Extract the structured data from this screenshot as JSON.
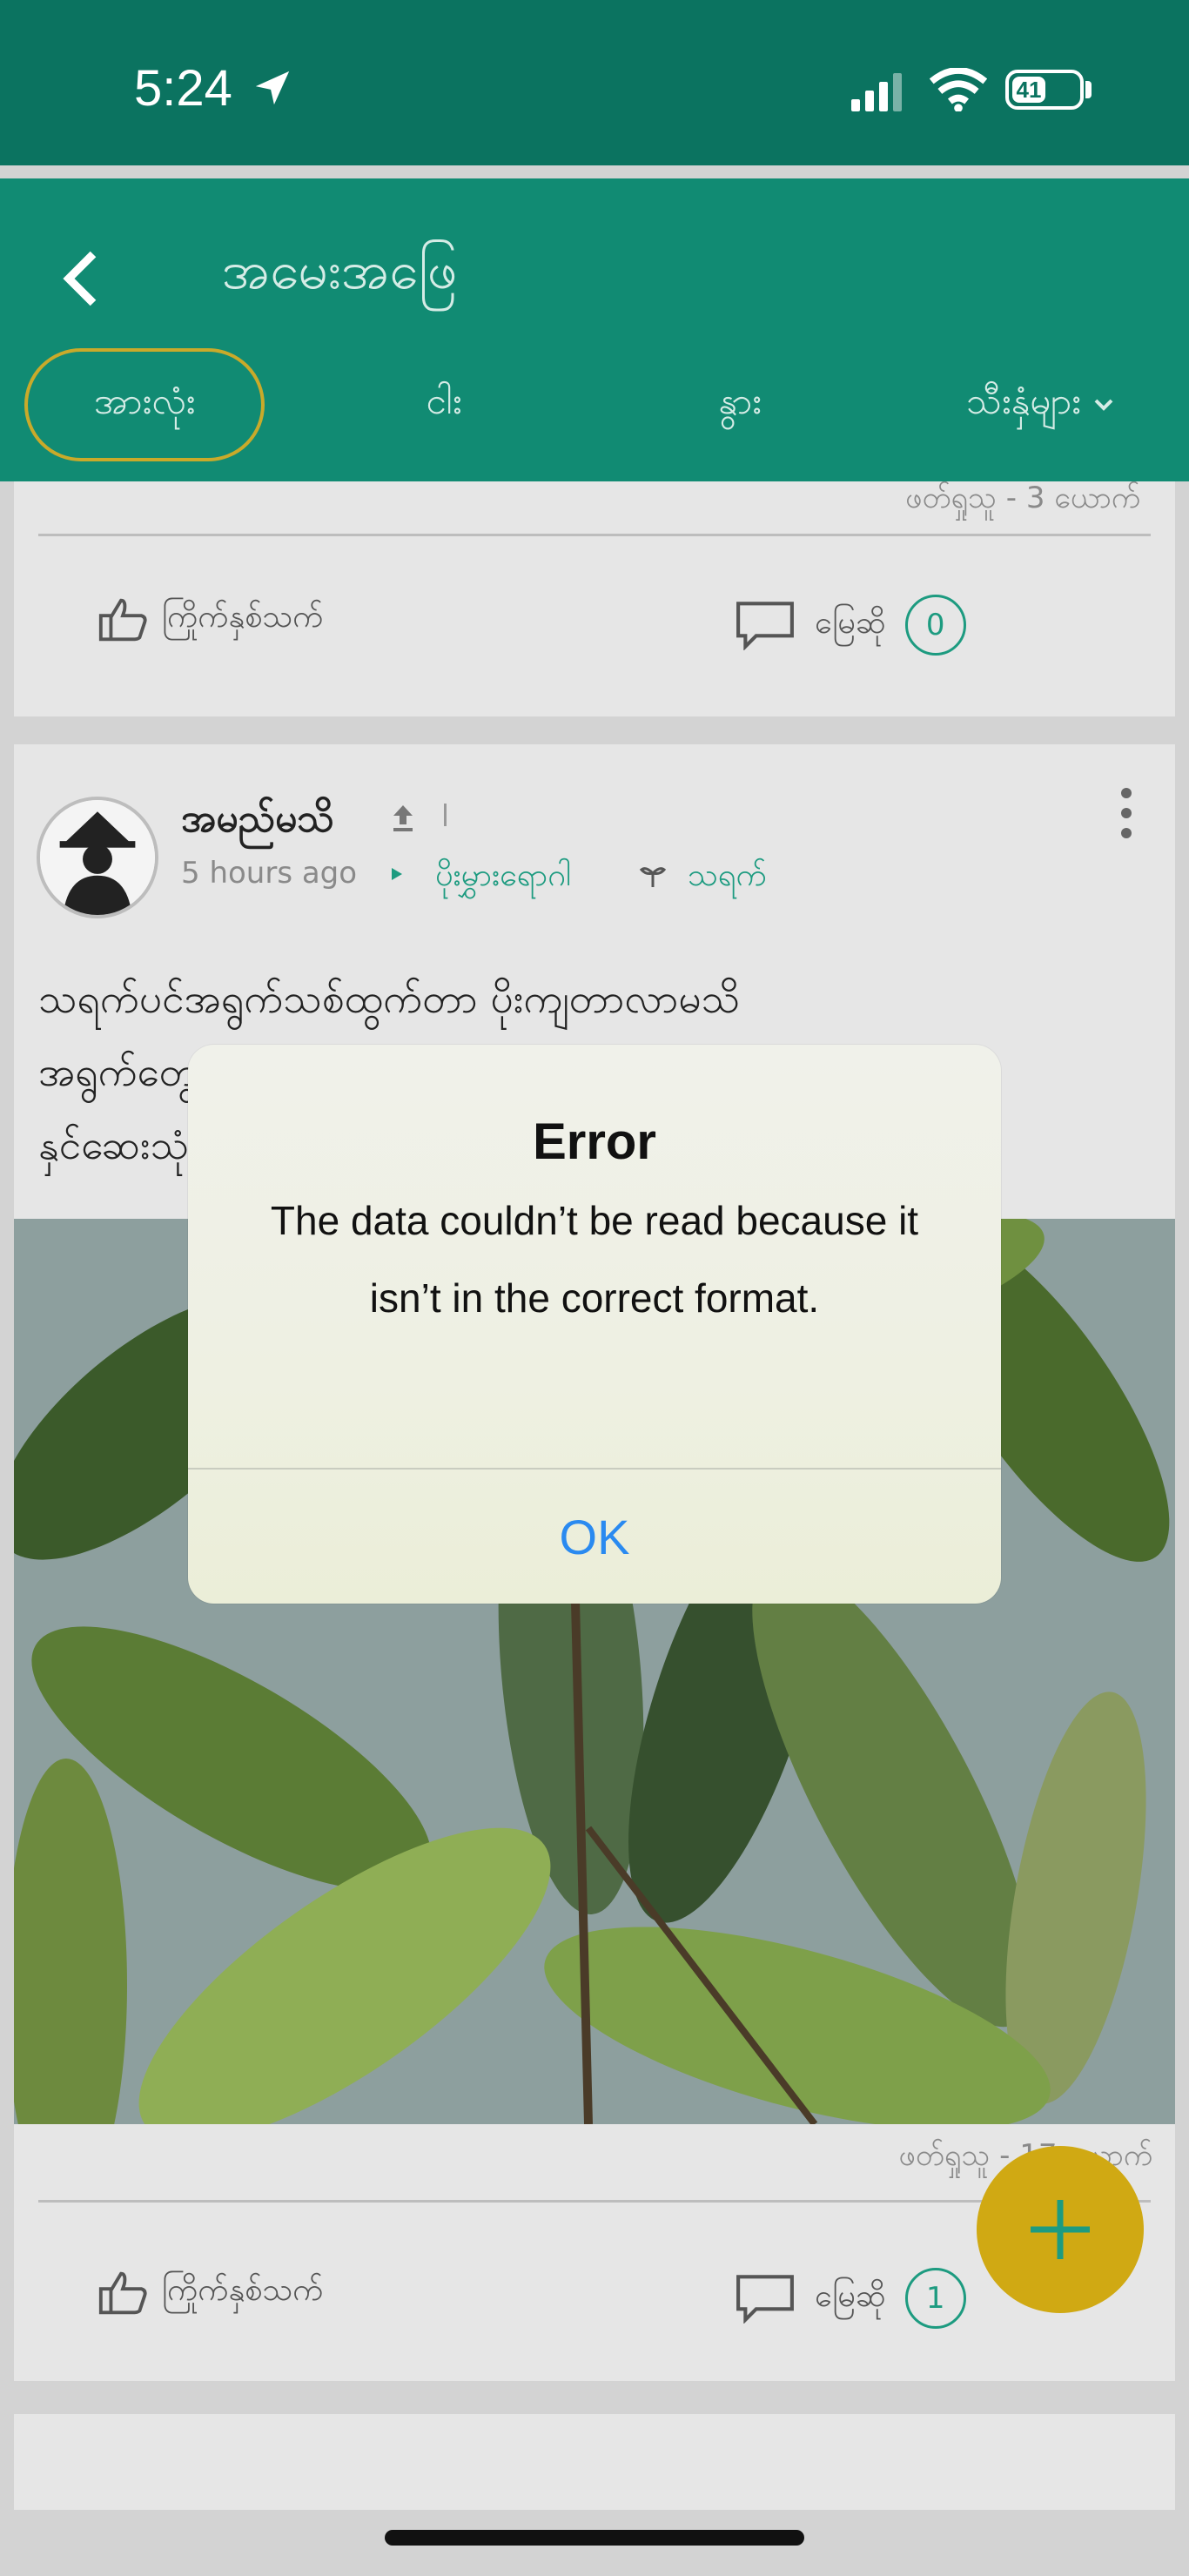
{
  "status_bar": {
    "time": "5:24",
    "battery": "41",
    "icons": [
      "location-arrow-icon",
      "signal-icon",
      "wifi-icon",
      "battery-icon"
    ]
  },
  "header": {
    "title": "အမေးအဖြေ",
    "tabs": [
      {
        "label": "အားလုံး",
        "active": true
      },
      {
        "label": "ငါး",
        "active": false
      },
      {
        "label": "နွား",
        "active": false
      },
      {
        "label": "သီးနှံများ",
        "active": false,
        "dropdown": true
      }
    ]
  },
  "previous_post": {
    "date_partial": "ဖတ်ရှုသူ - 3 ယောက်",
    "like_label": "ကြိုက်နှစ်သက်",
    "comment_label": "မြေဆို",
    "comment_count": "0"
  },
  "post": {
    "author": "အမည်မသိ",
    "time": "5 hours ago",
    "category": "ပိုးမွှားရောဂါ",
    "crop": "သရက်",
    "text": "သရက်ပင်အရွက်သစ်ထွက်တာ ပိုးကျတာလာမသိ\nအရွက်တွေ ပိုးကျပြီး ပုပ်သွားတယ် ဘယ်လိုဆေးဖြန်းစားပိုး\nနှင်ဆေးသုံးရမလဲ",
    "views": "ဖတ်ရှုသူ - 17 ယောက်",
    "like_label": "ကြိုက်နှစ်သက်",
    "comment_label": "မြေဆို",
    "comment_count": "1"
  },
  "dialog": {
    "title": "Error",
    "message": "The data couldn’t be read because it isn’t in the correct format.",
    "ok_label": "OK"
  },
  "colors": {
    "header": "#118b73",
    "status": "#0b7360",
    "accent": "#1d9b80",
    "fab": "#d0a913",
    "ok": "#2a8af0"
  }
}
